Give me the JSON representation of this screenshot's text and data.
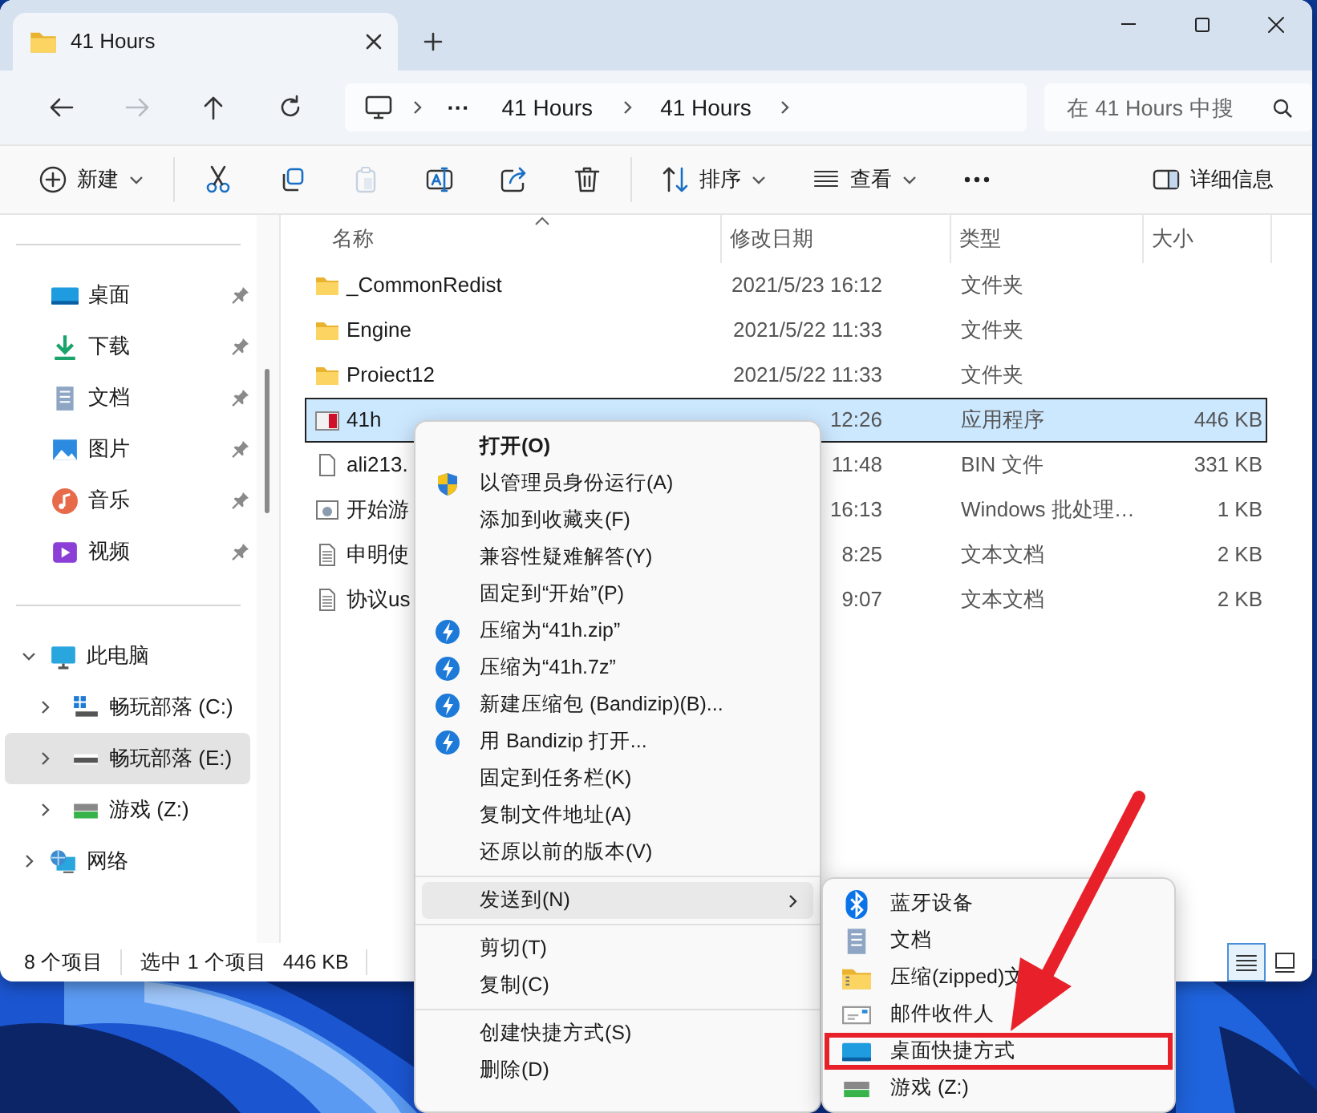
{
  "tab": {
    "title": "41 Hours"
  },
  "nav": [
    {
      "kind": "back",
      "disabled": false
    },
    {
      "kind": "forward",
      "disabled": true
    },
    {
      "kind": "up",
      "disabled": false
    },
    {
      "kind": "refresh",
      "disabled": false
    }
  ],
  "address": {
    "overflow": "···",
    "crumbs": [
      "41 Hours",
      "41 Hours"
    ]
  },
  "search": {
    "placeholder": "在 41 Hours 中搜"
  },
  "toolbar": [
    {
      "kind": "new",
      "label": "新建",
      "caret": true,
      "disabled": false
    },
    {
      "kind": "divider"
    },
    {
      "kind": "cut",
      "disabled": false
    },
    {
      "kind": "copy",
      "disabled": false
    },
    {
      "kind": "paste",
      "disabled": true
    },
    {
      "kind": "rename",
      "disabled": false
    },
    {
      "kind": "share",
      "disabled": false
    },
    {
      "kind": "delete",
      "disabled": false
    },
    {
      "kind": "divider"
    },
    {
      "kind": "sort",
      "label": "排序",
      "caret": true,
      "disabled": false
    },
    {
      "kind": "view",
      "label": "查看",
      "caret": true,
      "disabled": false
    },
    {
      "kind": "more",
      "disabled": false
    },
    {
      "kind": "details",
      "label": "详细信息",
      "disabled": false
    }
  ],
  "sidebar": {
    "quick_access": [
      {
        "label": "桌面",
        "kind": "desktop",
        "pinned": true
      },
      {
        "label": "下载",
        "kind": "download",
        "pinned": true
      },
      {
        "label": "文档",
        "kind": "docs",
        "pinned": true
      },
      {
        "label": "图片",
        "kind": "pictures",
        "pinned": true
      },
      {
        "label": "音乐",
        "kind": "music",
        "pinned": true
      },
      {
        "label": "视频",
        "kind": "video",
        "pinned": true
      }
    ],
    "tree": [
      {
        "label": "此电脑",
        "kind": "pc",
        "expanded": true,
        "selected": false,
        "children": [
          {
            "label": "畅玩部落 (C:)",
            "kind": "drive-system",
            "expanded": false,
            "selected": false
          },
          {
            "label": "畅玩部落 (E:)",
            "kind": "drive",
            "expanded": false,
            "selected": true
          },
          {
            "label": "游戏 (Z:)",
            "kind": "drive-game",
            "expanded": false,
            "selected": false
          }
        ]
      },
      {
        "label": "网络",
        "kind": "network",
        "expanded": false,
        "selected": false
      }
    ]
  },
  "columns": [
    {
      "label": "名称",
      "sorted": true
    },
    {
      "label": "修改日期",
      "sorted": false
    },
    {
      "label": "类型",
      "sorted": false
    },
    {
      "label": "大小",
      "sorted": false
    }
  ],
  "files": [
    {
      "name": "_CommonRedist",
      "date": "2021/5/23 16:12",
      "type": "文件夹",
      "kind": "folder",
      "selected": false
    },
    {
      "name": "Engine",
      "date": "2021/5/22 11:33",
      "type": "文件夹",
      "kind": "folder",
      "selected": false
    },
    {
      "name": "Proiect12",
      "date": "2021/5/22 11:33",
      "type": "文件夹",
      "kind": "folder",
      "selected": false
    },
    {
      "name": "41h",
      "date": "12:26",
      "type": "应用程序",
      "size": "446 KB",
      "kind": "app",
      "selected": true
    },
    {
      "name": "ali213.",
      "date": "11:48",
      "type": "BIN 文件",
      "size": "331 KB",
      "kind": "file",
      "selected": false
    },
    {
      "name": "开始游",
      "date": "16:13",
      "type": "Windows 批处理…",
      "size": "1 KB",
      "kind": "script",
      "selected": false
    },
    {
      "name": "申明使",
      "date": "8:25",
      "type": "文本文档",
      "size": "2 KB",
      "kind": "text",
      "selected": false
    },
    {
      "name": "协议us",
      "date": "9:07",
      "type": "文本文档",
      "size": "2 KB",
      "kind": "text",
      "selected": false
    }
  ],
  "status_bar": {
    "count": "8 个项目",
    "selection": "选中 1 个项目",
    "size": "446 KB",
    "views": [
      {
        "kind": "details",
        "selected": true
      },
      {
        "kind": "tiles",
        "selected": false
      }
    ]
  },
  "context_menu": {
    "items": [
      {
        "kind": "plain",
        "label": "打开(O)",
        "bold": true,
        "selected": false
      },
      {
        "kind": "shield",
        "label": "以管理员身份运行(A)",
        "bold": false,
        "selected": false
      },
      {
        "kind": "plain",
        "label": "添加到收藏夹(F)",
        "bold": false,
        "selected": false
      },
      {
        "kind": "plain",
        "label": "兼容性疑难解答(Y)",
        "bold": false,
        "selected": false
      },
      {
        "kind": "plain",
        "label": "固定到“开始”(P)",
        "bold": false,
        "selected": false
      },
      {
        "kind": "bandizip",
        "label": "压缩为“41h.zip”",
        "bold": false,
        "selected": false
      },
      {
        "kind": "bandizip",
        "label": "压缩为“41h.7z”",
        "bold": false,
        "selected": false
      },
      {
        "kind": "bandizip",
        "label": "新建压缩包 (Bandizip)(B)...",
        "bold": false,
        "selected": false
      },
      {
        "kind": "bandizip",
        "label": "用 Bandizip 打开...",
        "bold": false,
        "selected": false
      },
      {
        "kind": "plain",
        "label": "固定到任务栏(K)",
        "bold": false,
        "selected": false
      },
      {
        "kind": "plain",
        "label": "复制文件地址(A)",
        "bold": false,
        "selected": false
      },
      {
        "kind": "plain",
        "label": "还原以前的版本(V)",
        "bold": false,
        "selected": false
      },
      {
        "kind": "separator"
      },
      {
        "kind": "submenu",
        "label": "发送到(N)",
        "bold": false,
        "selected": true
      },
      {
        "kind": "separator"
      },
      {
        "kind": "plain",
        "label": "剪切(T)",
        "bold": false,
        "selected": false
      },
      {
        "kind": "plain",
        "label": "复制(C)",
        "bold": false,
        "selected": false
      },
      {
        "kind": "separator"
      },
      {
        "kind": "plain",
        "label": "创建快捷方式(S)",
        "bold": false,
        "selected": false
      },
      {
        "kind": "plain",
        "label": "删除(D)",
        "bold": false,
        "selected": false
      }
    ]
  },
  "send_to_menu": {
    "items": [
      {
        "label": "蓝牙设备",
        "kind": "bluetooth",
        "highlighted": false
      },
      {
        "label": "文档",
        "kind": "docs",
        "highlighted": false
      },
      {
        "label": "压缩(zipped)文",
        "kind": "zip",
        "highlighted": false
      },
      {
        "label": "邮件收件人",
        "kind": "mail",
        "highlighted": false
      },
      {
        "label": "桌面快捷方式",
        "kind": "desktop",
        "highlighted": true
      },
      {
        "label": "游戏 (Z:)",
        "kind": "drive-game",
        "highlighted": false
      }
    ]
  }
}
